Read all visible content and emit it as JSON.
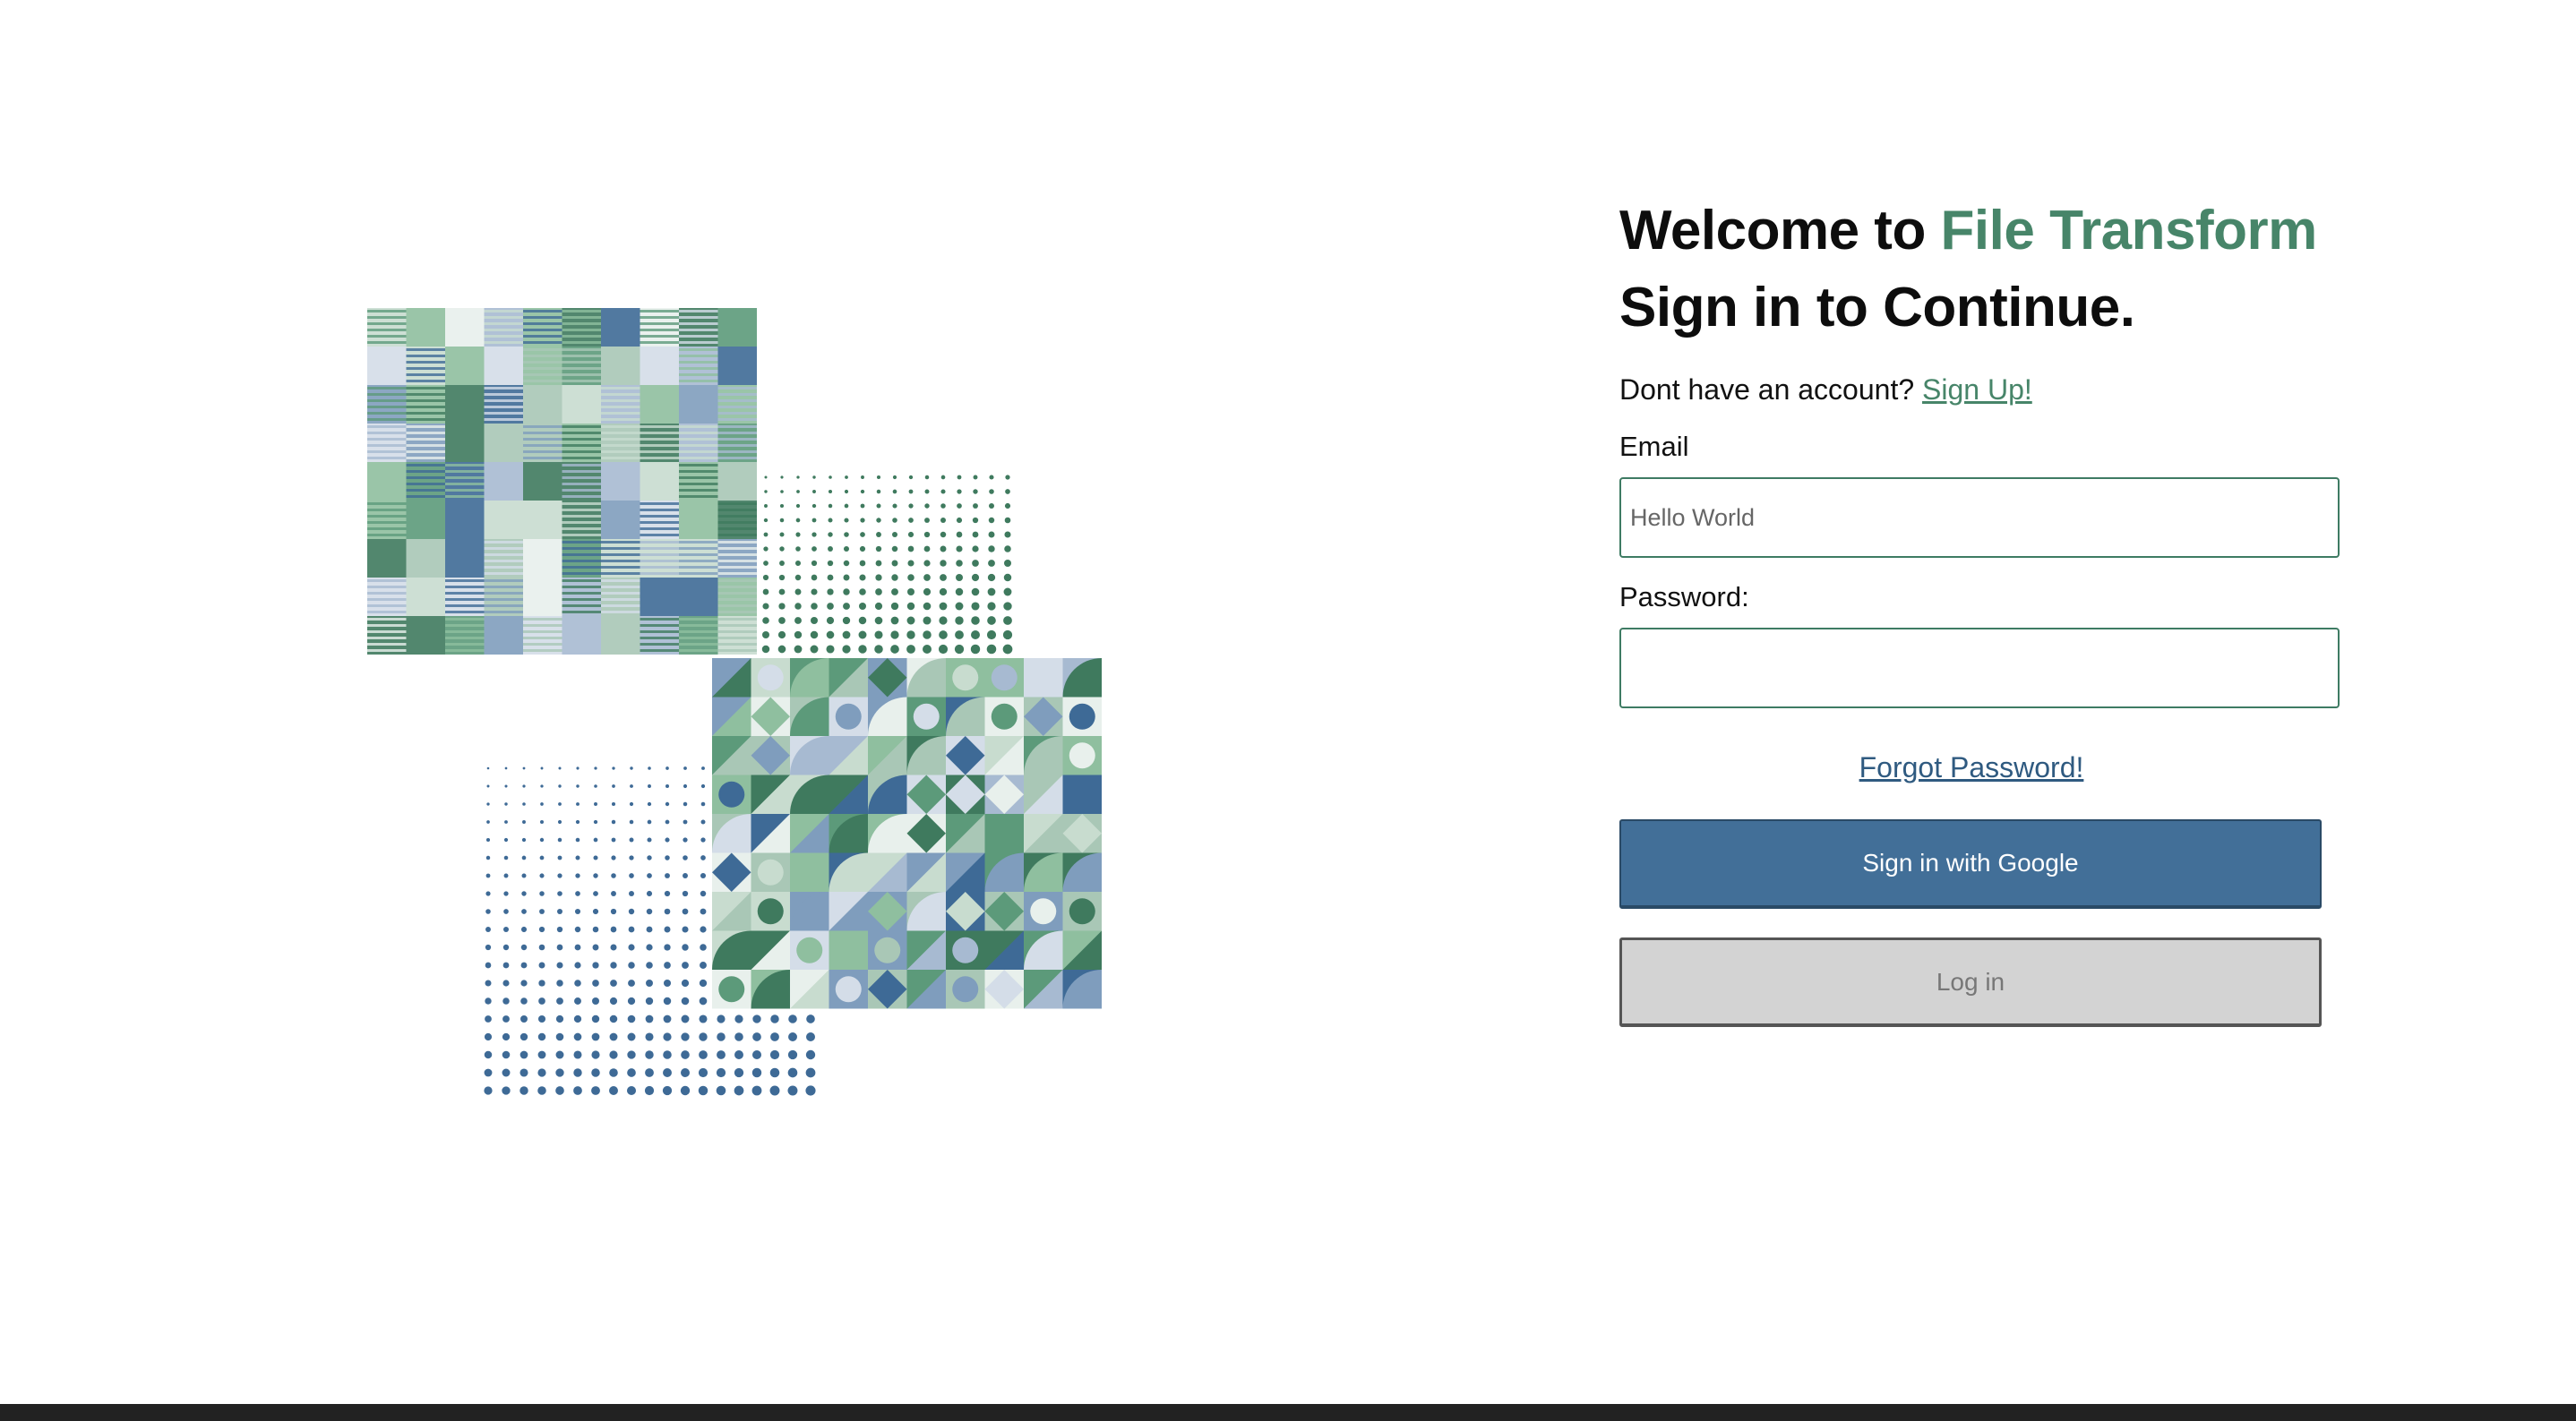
{
  "login": {
    "headline_prefix": "Welcome to ",
    "brand_name": "File Transform",
    "headline_line2": "Sign in to Continue.",
    "signup_prompt": "Dont have an account? ",
    "signup_link": "Sign Up!",
    "email_label": "Email",
    "email_placeholder": "Hello World",
    "password_label": "Password:",
    "forgot_password": "Forgot Password!",
    "google_button": "Sign in with Google",
    "login_button": "Log in"
  },
  "colors": {
    "brand_green": "#478569",
    "link_blue": "#2f5a80",
    "google_button_bg": "#426f98",
    "login_button_bg": "#d3d3d3",
    "input_border": "#3e7b63"
  },
  "icons": {
    "illustration": "abstract-geometric-pattern-collage"
  }
}
